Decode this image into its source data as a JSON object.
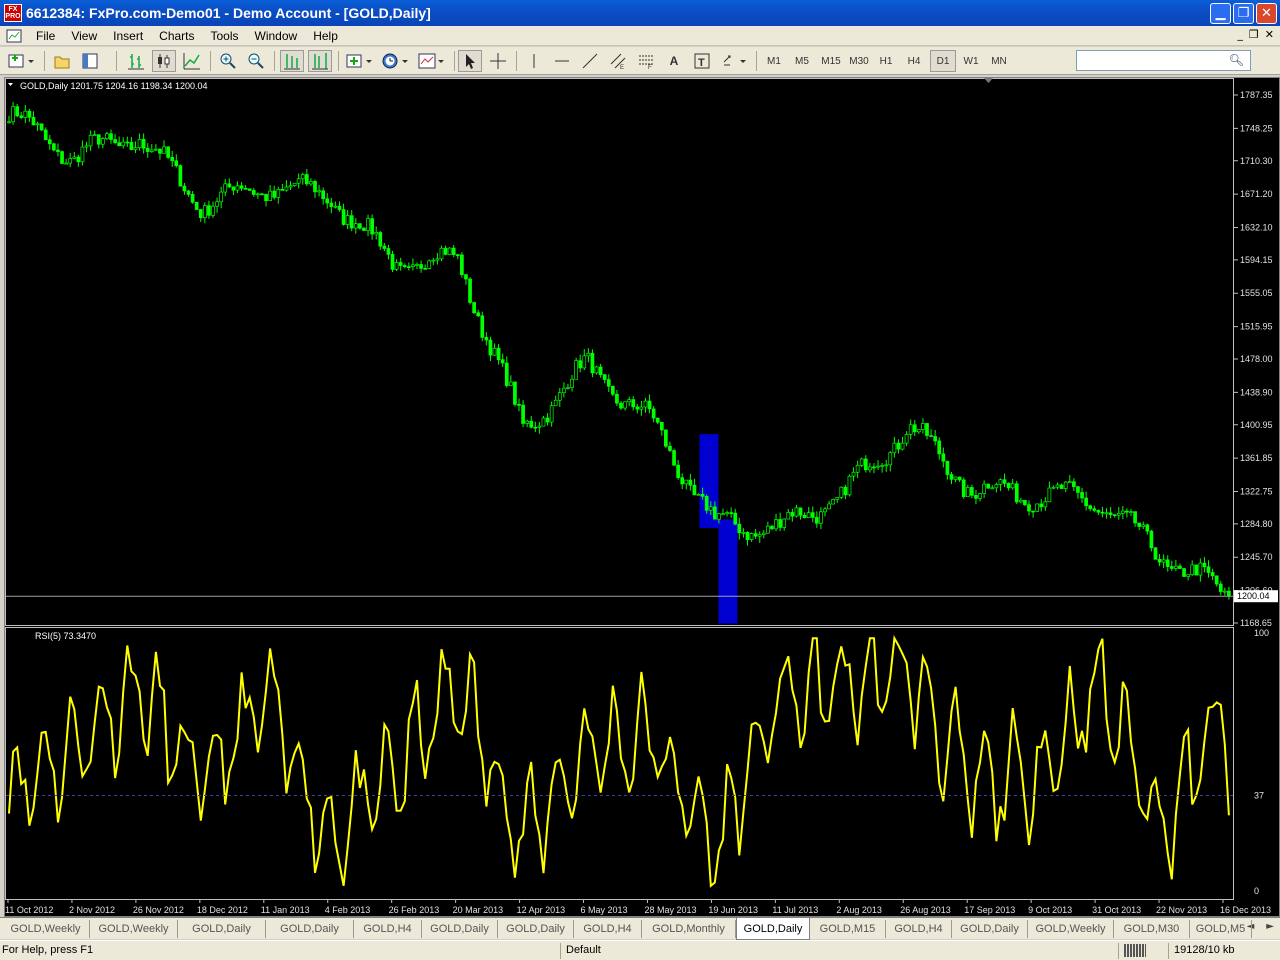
{
  "window": {
    "title": "6612384: FxPro.com-Demo01 - Demo Account - [GOLD,Daily]",
    "app_icon_text": "FX PRO"
  },
  "menu": [
    "File",
    "View",
    "Insert",
    "Charts",
    "Tools",
    "Window",
    "Help"
  ],
  "toolbar": {
    "timeframes": [
      "M1",
      "M5",
      "M15",
      "M30",
      "H1",
      "H4",
      "D1",
      "W1",
      "MN"
    ],
    "active_timeframe": "D1",
    "search_placeholder": ""
  },
  "chart": {
    "header": "GOLD,Daily  1201.75 1204.16 1198.34 1200.04",
    "current_price_label": "1200.04",
    "price_ticks": [
      "1787.35",
      "1748.25",
      "1710.30",
      "1671.20",
      "1632.10",
      "1594.15",
      "1555.05",
      "1515.95",
      "1478.00",
      "1438.90",
      "1400.95",
      "1361.85",
      "1322.75",
      "1284.80",
      "1245.70",
      "1206.60",
      "1168.65"
    ],
    "indicator_label": "RSI(5) 73.3470",
    "rsi_ticks": [
      "100",
      "37",
      "0"
    ],
    "date_labels": [
      "11 Oct 2012",
      "2 Nov 2012",
      "26 Nov 2012",
      "18 Dec 2012",
      "11 Jan 2013",
      "4 Feb 2013",
      "26 Feb 2013",
      "20 Mar 2013",
      "12 Apr 2013",
      "6 May 2013",
      "28 May 2013",
      "19 Jun 2013",
      "11 Jul 2013",
      "2 Aug 2013",
      "26 Aug 2013",
      "17 Sep 2013",
      "9 Oct 2013",
      "31 Oct 2013",
      "22 Nov 2013",
      "16 Dec 2013"
    ],
    "colors": {
      "background": "#000000",
      "candles": "#00ff00",
      "rsi_line": "#ffff00",
      "rsi_level": "#4040a0",
      "highlight": "#0000d0",
      "price_line": "#a0a0b0"
    }
  },
  "chart_data": {
    "type": "line",
    "title": "GOLD,Daily",
    "x": [
      "11 Oct 2012",
      "2 Nov 2012",
      "26 Nov 2012",
      "18 Dec 2012",
      "11 Jan 2013",
      "4 Feb 2013",
      "26 Feb 2013",
      "20 Mar 2013",
      "12 Apr 2013",
      "6 May 2013",
      "28 May 2013",
      "19 Jun 2013",
      "11 Jul 2013",
      "2 Aug 2013",
      "26 Aug 2013",
      "17 Sep 2013",
      "9 Oct 2013",
      "31 Oct 2013",
      "22 Nov 2013",
      "16 Dec 2013"
    ],
    "series": [
      {
        "name": "GOLD,Daily",
        "values": [
          1765,
          1715,
          1740,
          1660,
          1680,
          1670,
          1590,
          1595,
          1395,
          1470,
          1405,
          1285,
          1280,
          1320,
          1400,
          1325,
          1320,
          1310,
          1245,
          1200
        ]
      },
      {
        "name": "RSI(5)",
        "values": [
          40,
          55,
          80,
          40,
          75,
          20,
          45,
          80,
          20,
          55,
          60,
          15,
          75,
          80,
          85,
          40,
          45,
          80,
          25,
          73.347
        ]
      }
    ],
    "ylim": [
      1160,
      1800
    ],
    "rsi_range": [
      0,
      100
    ],
    "rsi_level": 37,
    "ohlc_last": {
      "open": 1201.75,
      "high": 1204.16,
      "low": 1198.34,
      "close": 1200.04
    },
    "grid": false
  },
  "tabs": [
    "GOLD,Weekly",
    "GOLD,Weekly",
    "GOLD,Daily",
    "GOLD,Daily",
    "GOLD,H4",
    "GOLD,Daily",
    "GOLD,Daily",
    "GOLD,H4",
    "GOLD,Monthly",
    "GOLD,Daily",
    "GOLD,M15",
    "GOLD,H4",
    "GOLD,Daily",
    "GOLD,Weekly",
    "GOLD,M30",
    "GOLD,M5"
  ],
  "active_tab_index": 9,
  "status": {
    "help": "For Help, press F1",
    "profile": "Default",
    "traffic": "19128/10 kb"
  }
}
